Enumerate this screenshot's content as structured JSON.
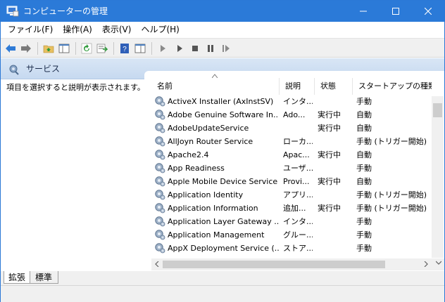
{
  "window": {
    "title": "コンピューターの管理",
    "accent": "#2b7ad8"
  },
  "menu": [
    {
      "label": "ファイル(F)"
    },
    {
      "label": "操作(A)"
    },
    {
      "label": "表示(V)"
    },
    {
      "label": "ヘルプ(H)"
    }
  ],
  "header": {
    "title": "サービス"
  },
  "description": {
    "text": "項目を選択すると説明が表示されます。"
  },
  "columns": {
    "name": "名前",
    "desc": "説明",
    "state": "状態",
    "start": "スタートアップの種類"
  },
  "rows": [
    {
      "name": "ActiveX Installer (AxInstSV)",
      "desc": "インタ...",
      "state": "",
      "start": "手動"
    },
    {
      "name": "Adobe Genuine Software In...",
      "desc": "Ado...",
      "state": "実行中",
      "start": "自動"
    },
    {
      "name": "AdobeUpdateService",
      "desc": "",
      "state": "実行中",
      "start": "自動"
    },
    {
      "name": "AllJoyn Router Service",
      "desc": "ローカ...",
      "state": "",
      "start": "手動 (トリガー開始)"
    },
    {
      "name": "Apache2.4",
      "desc": "Apac...",
      "state": "実行中",
      "start": "自動"
    },
    {
      "name": "App Readiness",
      "desc": "ユーザ...",
      "state": "",
      "start": "手動"
    },
    {
      "name": "Apple Mobile Device Service",
      "desc": "Provi...",
      "state": "実行中",
      "start": "自動"
    },
    {
      "name": "Application Identity",
      "desc": "アプリ...",
      "state": "",
      "start": "手動 (トリガー開始)"
    },
    {
      "name": "Application Information",
      "desc": "追加...",
      "state": "実行中",
      "start": "手動 (トリガー開始)"
    },
    {
      "name": "Application Layer Gateway ...",
      "desc": "インタ...",
      "state": "",
      "start": "手動"
    },
    {
      "name": "Application Management",
      "desc": "グルー...",
      "state": "",
      "start": "手動"
    },
    {
      "name": "AppX Deployment Service (...",
      "desc": "ストア...",
      "state": "",
      "start": "手動"
    }
  ],
  "tabs": [
    {
      "label": "拡張"
    },
    {
      "label": "標準"
    }
  ]
}
